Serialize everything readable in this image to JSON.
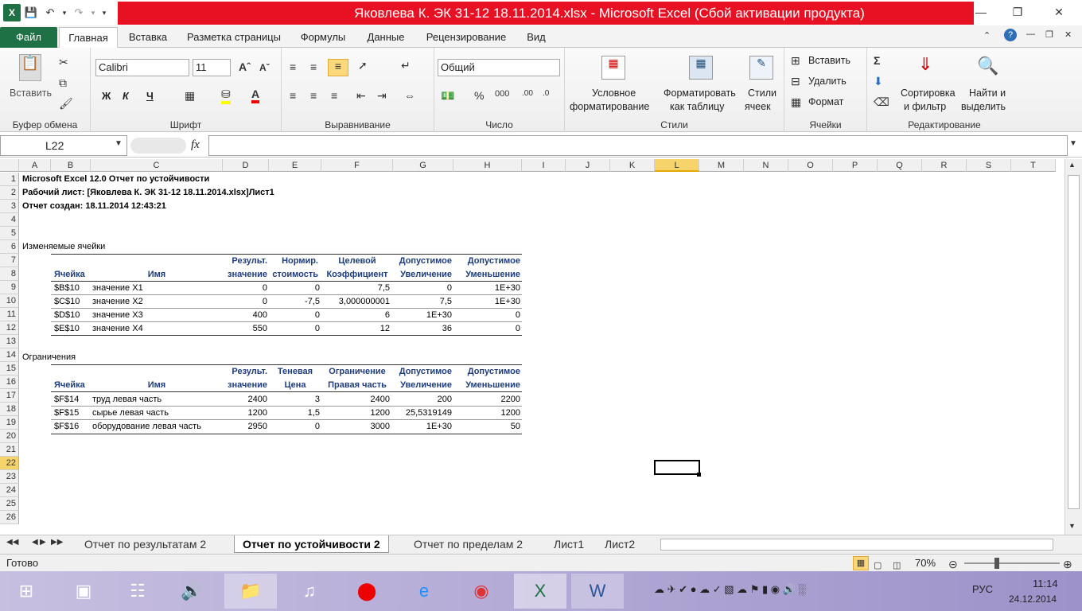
{
  "window": {
    "title": "Яковлева К. ЭК 31-12 18.11.2014.xlsx  -  Microsoft Excel (Сбой активации продукта)"
  },
  "qat": {
    "logo": "X"
  },
  "tabs": [
    "Файл",
    "Главная",
    "Вставка",
    "Разметка страницы",
    "Формулы",
    "Данные",
    "Рецензирование",
    "Вид"
  ],
  "ribbon": {
    "clipboard": {
      "paste": "Вставить",
      "label": "Буфер обмена"
    },
    "font": {
      "name": "Calibri",
      "size": "11",
      "bold": "Ж",
      "italic": "К",
      "underline": "Ч",
      "label": "Шрифт"
    },
    "alignment": {
      "label": "Выравнивание"
    },
    "number": {
      "format": "Общий",
      "label": "Число"
    },
    "styles": {
      "cond_line1": "Условное",
      "cond_line2": "форматирование",
      "table_line1": "Форматировать",
      "table_line2": "как таблицу",
      "cell_line1": "Стили",
      "cell_line2": "ячеек",
      "label": "Стили"
    },
    "cells": {
      "insert": "Вставить",
      "delete": "Удалить",
      "format": "Формат",
      "label": "Ячейки"
    },
    "editing": {
      "sort_line1": "Сортировка",
      "sort_line2": "и фильтр",
      "find_line1": "Найти и",
      "find_line2": "выделить",
      "label": "Редактирование"
    }
  },
  "formula_bar": {
    "name_box": "L22",
    "fx": "fx",
    "value": ""
  },
  "columns": [
    "A",
    "B",
    "C",
    "D",
    "E",
    "F",
    "G",
    "H",
    "I",
    "J",
    "K",
    "L",
    "M",
    "N",
    "O",
    "P",
    "Q",
    "R",
    "S",
    "T"
  ],
  "selected_column": "L",
  "rows": [
    "1",
    "2",
    "3",
    "4",
    "5",
    "6",
    "7",
    "8",
    "9",
    "10",
    "11",
    "12",
    "13",
    "14",
    "15",
    "16",
    "17",
    "18",
    "19",
    "20",
    "21",
    "22",
    "23",
    "24",
    "25",
    "26"
  ],
  "selected_row": "22",
  "report": {
    "line1": "Microsoft Excel 12.0 Отчет по устойчивости",
    "line2": "Рабочий лист: [Яковлева К. ЭК 31-12 18.11.2014.xlsx]Лист1",
    "line3": "Отчет создан: 18.11.2014 12:43:21",
    "section1": "Изменяемые ячейки",
    "t1_head1": [
      "Результ.",
      "Нормир.",
      "Целевой",
      "Допустимое",
      "Допустимое"
    ],
    "t1_head2": [
      "Ячейка",
      "Имя",
      "значение",
      "стоимость",
      "Коэффициент",
      "Увеличение",
      "Уменьшение"
    ],
    "t1_rows": [
      [
        "$B$10",
        "значение X1",
        "0",
        "0",
        "7,5",
        "0",
        "1E+30"
      ],
      [
        "$C$10",
        "значение X2",
        "0",
        "-7,5",
        "3,000000001",
        "7,5",
        "1E+30"
      ],
      [
        "$D$10",
        "значение X3",
        "400",
        "0",
        "6",
        "1E+30",
        "0"
      ],
      [
        "$E$10",
        "значение X4",
        "550",
        "0",
        "12",
        "36",
        "0"
      ]
    ],
    "section2": "Ограничения",
    "t2_head1": [
      "Результ.",
      "Теневая",
      "Ограничение",
      "Допустимое",
      "Допустимое"
    ],
    "t2_head2": [
      "Ячейка",
      "Имя",
      "значение",
      "Цена",
      "Правая часть",
      "Увеличение",
      "Уменьшение"
    ],
    "t2_rows": [
      [
        "$F$14",
        "труд  левая часть",
        "2400",
        "3",
        "2400",
        "200",
        "2200"
      ],
      [
        "$F$15",
        "сырье  левая часть",
        "1200",
        "1,5",
        "1200",
        "25,5319149",
        "1200"
      ],
      [
        "$F$16",
        "оборудование левая часть",
        "2950",
        "0",
        "3000",
        "1E+30",
        "50"
      ]
    ]
  },
  "sheet_tabs": [
    "Отчет по результатам 2",
    "Отчет по устойчивости 2",
    "Отчет по пределам 2",
    "Лист1",
    "Лист2"
  ],
  "active_sheet": "Отчет по устойчивости 2",
  "status": {
    "ready": "Готово",
    "zoom": "70%"
  },
  "taskbar": {
    "lang": "РУС",
    "time": "11:14",
    "date": "24.12.2014"
  }
}
